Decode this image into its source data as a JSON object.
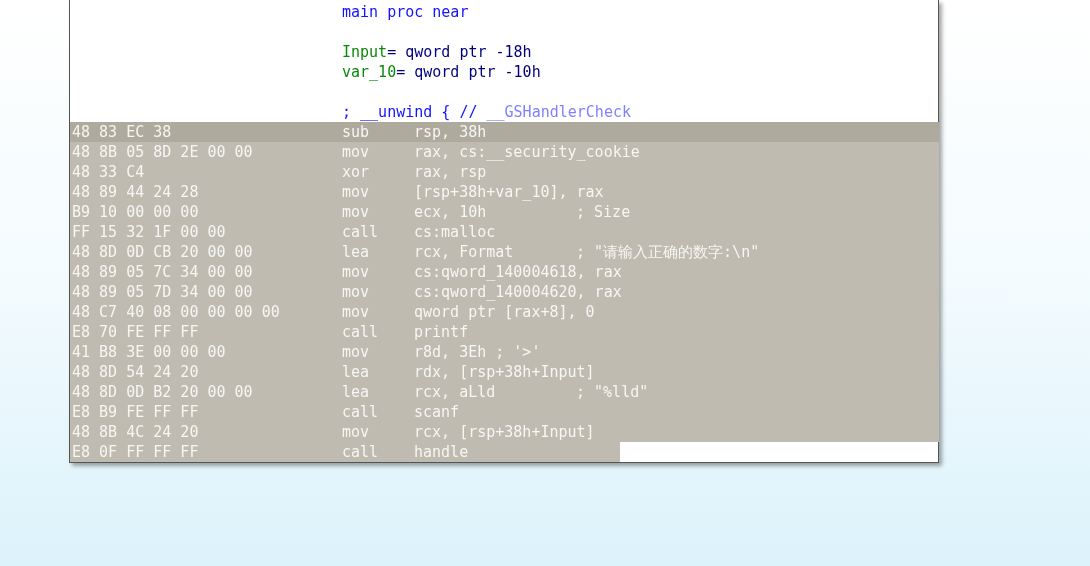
{
  "header": [
    {
      "lines": [
        [
          {
            "kind": "keyword",
            "text": "main proc near"
          }
        ]
      ]
    },
    {
      "lines": [
        [
          {
            "kind": "var",
            "text": "Input"
          },
          {
            "kind": "plain",
            "text": "= qword ptr -18h"
          }
        ],
        [
          {
            "kind": "var",
            "text": "var_10"
          },
          {
            "kind": "plain",
            "text": "= qword ptr -10h"
          }
        ]
      ]
    },
    {
      "lines": [
        [
          {
            "kind": "keyword",
            "text": "; __unwind { // "
          },
          {
            "kind": "ref",
            "text": "__GSHandlerCheck"
          }
        ]
      ]
    }
  ],
  "instructions": [
    {
      "bytes": "48 83 EC 38",
      "mnemonic": "sub",
      "operands": "rsp, 38h",
      "selected": true,
      "full_width": true
    },
    {
      "bytes": "48 8B 05 8D 2E 00 00",
      "mnemonic": "mov",
      "operands": "rax, cs:__security_cookie",
      "selected": false,
      "full_width": true
    },
    {
      "bytes": "48 33 C4",
      "mnemonic": "xor",
      "operands": "rax, rsp",
      "selected": false,
      "full_width": true
    },
    {
      "bytes": "48 89 44 24 28",
      "mnemonic": "mov",
      "operands": "[rsp+38h+var_10], rax",
      "selected": false,
      "full_width": true
    },
    {
      "bytes": "B9 10 00 00 00",
      "mnemonic": "mov",
      "operands": "ecx, 10h",
      "comment": "; Size",
      "selected": false,
      "full_width": true
    },
    {
      "bytes": "FF 15 32 1F 00 00",
      "mnemonic": "call",
      "operands": "cs:malloc",
      "selected": false,
      "full_width": true
    },
    {
      "bytes": "48 8D 0D CB 20 00 00",
      "mnemonic": "lea",
      "operands": "rcx, Format",
      "comment": "; \"请输入正确的数字:\\n\"",
      "selected": false,
      "full_width": true
    },
    {
      "bytes": "48 89 05 7C 34 00 00",
      "mnemonic": "mov",
      "operands": "cs:qword_140004618, rax",
      "selected": false,
      "full_width": true
    },
    {
      "bytes": "48 89 05 7D 34 00 00",
      "mnemonic": "mov",
      "operands": "cs:qword_140004620, rax",
      "selected": false,
      "full_width": true
    },
    {
      "bytes": "48 C7 40 08 00 00 00 00",
      "mnemonic": "mov",
      "operands": "qword ptr [rax+8], 0",
      "selected": false,
      "full_width": true
    },
    {
      "bytes": "E8 70 FE FF FF",
      "mnemonic": "call",
      "operands": "printf",
      "selected": false,
      "full_width": true
    },
    {
      "bytes": "41 B8 3E 00 00 00",
      "mnemonic": "mov",
      "operands": "r8d, 3Eh ; '>'",
      "selected": false,
      "full_width": true
    },
    {
      "bytes": "48 8D 54 24 20",
      "mnemonic": "lea",
      "operands": "rdx, [rsp+38h+Input]",
      "selected": false,
      "full_width": true
    },
    {
      "bytes": "48 8D 0D B2 20 00 00",
      "mnemonic": "lea",
      "operands": "rcx, aLld",
      "comment": "; \"%lld\"",
      "selected": false,
      "full_width": true
    },
    {
      "bytes": "E8 B9 FE FF FF",
      "mnemonic": "call",
      "operands": "scanf",
      "selected": false,
      "full_width": true
    },
    {
      "bytes": "48 8B 4C 24 20",
      "mnemonic": "mov",
      "operands": "rcx, [rsp+38h+Input]",
      "selected": false,
      "full_width": true
    },
    {
      "bytes": "E8 0F FF FF FF",
      "mnemonic": "call",
      "operands": "handle",
      "selected": false,
      "full_width": false
    }
  ]
}
